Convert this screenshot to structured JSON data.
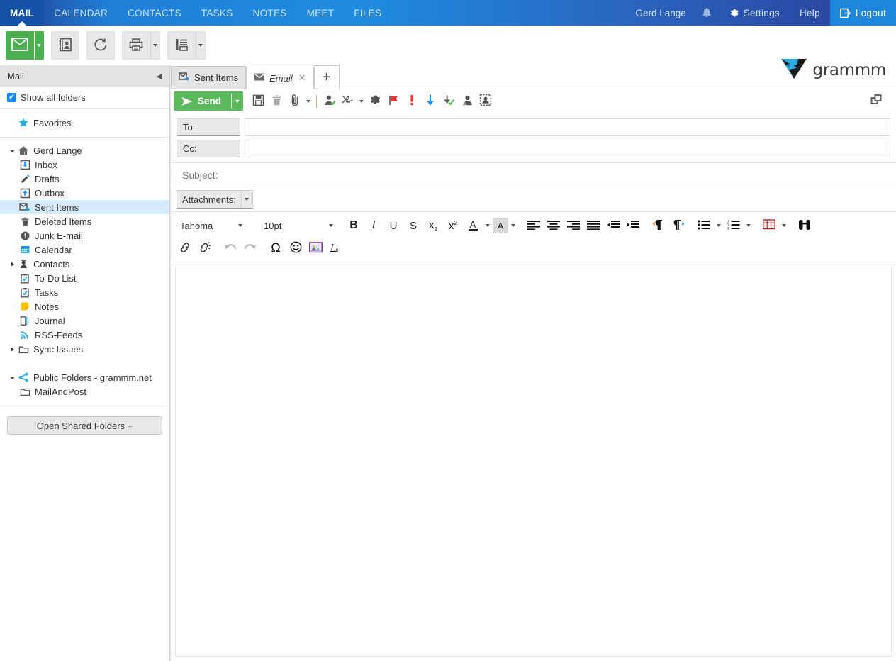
{
  "navbar": {
    "items": [
      {
        "label": "MAIL",
        "active": true
      },
      {
        "label": "CALENDAR",
        "active": false
      },
      {
        "label": "CONTACTS",
        "active": false
      },
      {
        "label": "TASKS",
        "active": false
      },
      {
        "label": "NOTES",
        "active": false
      },
      {
        "label": "MEET",
        "active": false
      },
      {
        "label": "FILES",
        "active": false
      }
    ],
    "user": "Gerd Lange",
    "settings": "Settings",
    "help": "Help",
    "logout": "Logout",
    "accent_active": "#1452a8",
    "accent_logout": "#1f86dd"
  },
  "apptoolbar": {
    "buttons": [
      {
        "name": "new-mail",
        "icon": "envelope-icon",
        "green": true,
        "dropdown": true
      },
      {
        "name": "new-contact",
        "icon": "address-book-icon",
        "green": false,
        "dropdown": false
      },
      {
        "name": "refresh",
        "icon": "refresh-icon",
        "green": false,
        "dropdown": false
      },
      {
        "name": "print",
        "icon": "printer-icon",
        "green": false,
        "dropdown": true
      },
      {
        "name": "view-layout",
        "icon": "layout-icon",
        "green": false,
        "dropdown": true
      }
    ],
    "logo_text": "grammm",
    "logo_color": "#29abe2"
  },
  "sidebar": {
    "title": "Mail",
    "collapse_icon": "collapse-left-icon",
    "show_all_folders": "Show all folders",
    "favorites": "Favorites",
    "open_shared": "Open Shared Folders +",
    "tree": [
      {
        "label": "Gerd Lange",
        "icon": "home-icon",
        "level": 0,
        "twisty": "down",
        "selected": false
      },
      {
        "label": "Inbox",
        "icon": "inbox-icon",
        "level": 1,
        "twisty": "",
        "selected": false
      },
      {
        "label": "Drafts",
        "icon": "pencil-icon",
        "level": 1,
        "twisty": "",
        "selected": false
      },
      {
        "label": "Outbox",
        "icon": "outbox-icon",
        "level": 1,
        "twisty": "",
        "selected": false
      },
      {
        "label": "Sent Items",
        "icon": "sent-icon",
        "level": 1,
        "twisty": "",
        "selected": true
      },
      {
        "label": "Deleted Items",
        "icon": "trash-icon",
        "level": 1,
        "twisty": "",
        "selected": false
      },
      {
        "label": "Junk E-mail",
        "icon": "junk-icon",
        "level": 1,
        "twisty": "",
        "selected": false
      },
      {
        "label": "Calendar",
        "icon": "calendar-icon",
        "level": 1,
        "twisty": "",
        "selected": false
      },
      {
        "label": "Contacts",
        "icon": "contacts-icon",
        "level": 1,
        "twisty": "right",
        "selected": false
      },
      {
        "label": "To-Do List",
        "icon": "todo-icon",
        "level": 1,
        "twisty": "",
        "selected": false
      },
      {
        "label": "Tasks",
        "icon": "tasks-icon",
        "level": 1,
        "twisty": "",
        "selected": false
      },
      {
        "label": "Notes",
        "icon": "notes-icon",
        "level": 1,
        "twisty": "",
        "selected": false
      },
      {
        "label": "Journal",
        "icon": "journal-icon",
        "level": 1,
        "twisty": "",
        "selected": false
      },
      {
        "label": "RSS-Feeds",
        "icon": "rss-icon",
        "level": 1,
        "twisty": "",
        "selected": false
      },
      {
        "label": "Sync Issues",
        "icon": "folder-icon",
        "level": 1,
        "twisty": "right",
        "selected": false
      }
    ],
    "public": [
      {
        "label": "Public Folders - grammm.net",
        "icon": "share-icon",
        "level": 0,
        "twisty": "down",
        "selected": false
      },
      {
        "label": "MailAndPost",
        "icon": "folder-icon",
        "level": 1,
        "twisty": "",
        "selected": false
      }
    ]
  },
  "tabs": [
    {
      "label": "Sent Items",
      "icon": "sent-icon",
      "active": false,
      "closable": false
    },
    {
      "label": "Email",
      "icon": "envelope-icon",
      "active": true,
      "closable": true
    }
  ],
  "tab_add": "+",
  "compose": {
    "send_label": "Send",
    "send_color": "#5cb85c",
    "icons": [
      {
        "name": "save-button",
        "icon": "floppy-icon",
        "dropdown": false
      },
      {
        "name": "discard-button",
        "icon": "trash-icon",
        "dropdown": false
      },
      {
        "name": "attachment-button",
        "icon": "paperclip-icon",
        "dropdown": true
      },
      {
        "name": "check-names-button",
        "icon": "person-check-icon",
        "dropdown": false
      },
      {
        "name": "signature-button",
        "icon": "signature-icon",
        "dropdown": true
      },
      {
        "name": "options-button",
        "icon": "gear-icon",
        "dropdown": false
      },
      {
        "name": "follow-up-button",
        "icon": "red-flag-icon",
        "dropdown": false
      },
      {
        "name": "high-priority-button",
        "icon": "exclamation-icon",
        "dropdown": false
      },
      {
        "name": "low-priority-button",
        "icon": "blue-down-arrow-icon",
        "dropdown": false
      },
      {
        "name": "read-receipt-button",
        "icon": "delivery-receipt-icon",
        "dropdown": false
      },
      {
        "name": "from-button",
        "icon": "person-icon",
        "dropdown": false
      },
      {
        "name": "stationery-button",
        "icon": "stamp-icon",
        "dropdown": false
      }
    ],
    "popout_icon": "popout-window-icon",
    "to_label": "To:",
    "to_value": "",
    "cc_label": "Cc:",
    "cc_value": "",
    "subject_placeholder": "Subject:",
    "subject_value": "",
    "attachments_label": "Attachments:",
    "body_value": ""
  },
  "editor": {
    "font_family": "Tahoma",
    "font_size": "10pt",
    "row1": [
      {
        "name": "bold-button",
        "icon": "bold-icon",
        "glyph": "B",
        "style": "bold"
      },
      {
        "name": "italic-button",
        "icon": "italic-icon",
        "glyph": "I",
        "style": "italic"
      },
      {
        "name": "underline-button",
        "icon": "underline-icon",
        "glyph": "U",
        "style": "underline"
      },
      {
        "name": "strikethrough-button",
        "icon": "strikethrough-icon",
        "glyph": "S",
        "style": "strike"
      },
      {
        "name": "subscript-button",
        "icon": "subscript-icon",
        "glyph": "x",
        "style": "sub"
      },
      {
        "name": "superscript-button",
        "icon": "superscript-icon",
        "glyph": "x",
        "style": "sup"
      }
    ],
    "font_color_label": "A",
    "highlight_label": "A",
    "align": [
      "align-left-icon",
      "align-center-icon",
      "align-right-icon",
      "align-justify-icon"
    ],
    "indent": [
      "outdent-icon",
      "indent-icon"
    ],
    "direction": [
      "ltr-paragraph-icon",
      "rtl-paragraph-icon"
    ],
    "lists": [
      "bullet-list-icon",
      "numbered-list-icon"
    ],
    "table_icon": "table-icon",
    "find_icon": "find-replace-icon",
    "row2": [
      {
        "name": "insert-link-button",
        "icon": "link-icon",
        "disabled": false
      },
      {
        "name": "remove-link-button",
        "icon": "unlink-icon",
        "disabled": false
      },
      {
        "name": "undo-button",
        "icon": "undo-icon",
        "disabled": true
      },
      {
        "name": "redo-button",
        "icon": "redo-icon",
        "disabled": true
      },
      {
        "name": "special-character-button",
        "icon": "omega-icon",
        "disabled": false
      },
      {
        "name": "emoticon-button",
        "icon": "smiley-icon",
        "disabled": false
      },
      {
        "name": "insert-image-button",
        "icon": "image-icon",
        "disabled": false
      },
      {
        "name": "clear-formatting-button",
        "icon": "clear-format-icon",
        "disabled": false
      }
    ]
  }
}
